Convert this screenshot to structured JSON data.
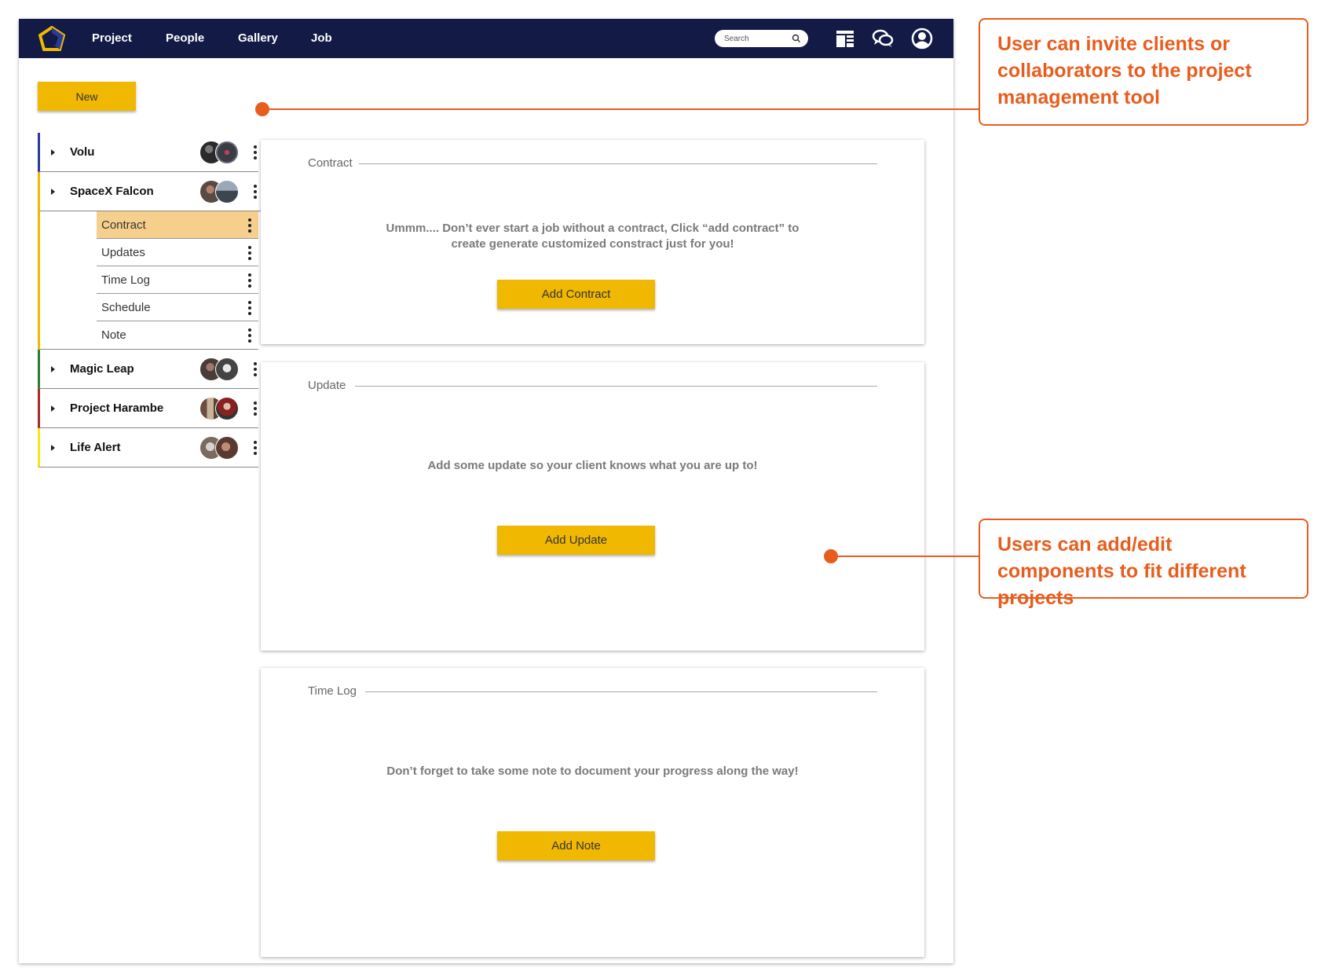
{
  "navbar": {
    "links": [
      "Project",
      "People",
      "Gallery",
      "Job"
    ],
    "search_placeholder": "Search",
    "bg_color": "#121a45",
    "icons": [
      "layout-icon",
      "chat-icon",
      "profile-icon"
    ]
  },
  "toolbar": {
    "new_label": "New"
  },
  "sidebar": {
    "projects": [
      {
        "name": "Volu",
        "accent": "#2b3a9a",
        "expanded": false
      },
      {
        "name": "SpaceX Falcon",
        "accent": "#f0b800",
        "expanded": true,
        "sub_items": [
          "Contract",
          "Updates",
          "Time Log",
          "Schedule",
          "Note"
        ],
        "active_sub_item": "Contract"
      },
      {
        "name": "Magic Leap",
        "accent": "#2e7d32",
        "expanded": false
      },
      {
        "name": "Project Harambe",
        "accent": "#a62b2b",
        "expanded": false
      },
      {
        "name": "Life Alert",
        "accent": "#f2e61d",
        "expanded": false
      }
    ]
  },
  "cards": {
    "contract": {
      "title": "Contract",
      "message_line1": "Ummm.... Don’t ever start a job without a contract, Click “add contract” to",
      "message_line2": "create generate customized constract just for you!",
      "button": "Add Contract"
    },
    "update": {
      "title": "Update",
      "message": "Add some update so your client knows what you are up to!",
      "button": "Add Update"
    },
    "timelog": {
      "title": "Time Log",
      "message": "Don’t forget to take some note to document your progress along the way!",
      "button": "Add Note"
    }
  },
  "annotations": [
    {
      "text": "User can invite clients or collaborators to the project management tool"
    },
    {
      "text": "Users can add/edit components to fit different projects"
    }
  ],
  "colors": {
    "accent_yellow": "#f0b800",
    "active_highlight": "#f7cf8d",
    "annotation_orange": "#e85d1e"
  }
}
